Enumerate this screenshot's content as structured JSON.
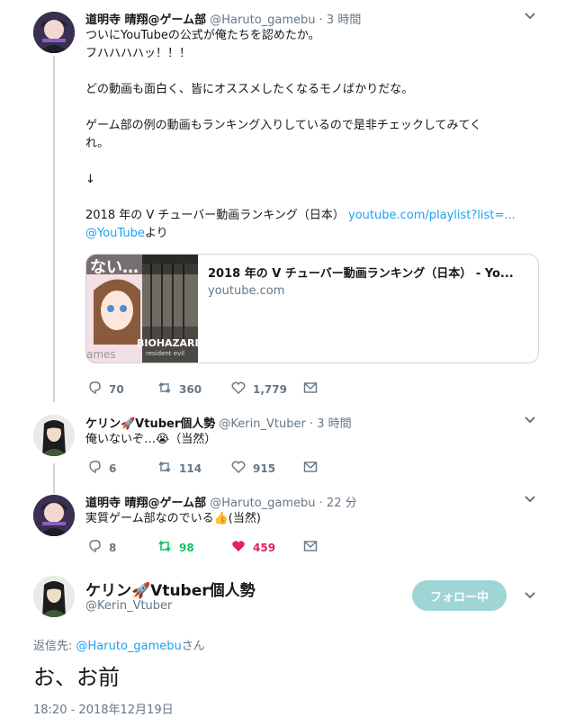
{
  "tweets": [
    {
      "name": "道明寺 晴翔@ゲーム部",
      "handle": "@Haruto_gamebu",
      "time": "· 3 時間",
      "lines": [
        "ついにYouTubeの公式が俺たちを認めたか。",
        "フハハハハッ！！！",
        "どの動画も面白く、皆にオススメしたくなるモノばかりだな。",
        "ゲーム部の例の動画もランキング入りしているので是非チェックしてみてく",
        "れ。",
        "↓",
        "2018 年の V チューバー動画ランキング（日本）"
      ],
      "link_url": "youtube.com/playlist?list=...",
      "mention": "@YouTube",
      "mention_suffix": "より",
      "card": {
        "title": "2018 年の V チューバー動画ランキング（日本） - Yo...",
        "domain": "youtube.com",
        "img_text_top": "ない…",
        "img_text_bottom": "BIOHAZARD",
        "img_text_sub": "resident evil",
        "img_text_left": "ames"
      },
      "replies": "70",
      "retweets": "360",
      "likes": "1,779"
    },
    {
      "name": "ケリン🚀Vtuber個人勢",
      "handle": "@Kerin_Vtuber",
      "time": "· 3 時間",
      "text": "俺いないぞ…😭（当然）",
      "replies": "6",
      "retweets": "114",
      "likes": "915"
    },
    {
      "name": "道明寺 晴翔@ゲーム部",
      "handle": "@Haruto_gamebu",
      "time": "· 22 分",
      "text": "実質ゲーム部なのでいる👍(当然)",
      "replies": "8",
      "retweets": "98",
      "likes": "459"
    }
  ],
  "focused": {
    "name": "ケリン🚀Vtuber個人勢",
    "handle": "@Kerin_Vtuber",
    "follow_label": "フォロー中",
    "reply_prefix": "返信先: ",
    "reply_handle": "@Haruto_gamebu",
    "reply_suffix": "さん",
    "text": "お、お前",
    "timestamp": "18:20 - 2018年12月19日"
  },
  "colors": {
    "link": "#1da1f2",
    "retweet_active": "#17bf63",
    "like_active": "#e0245e",
    "follow_button": "#9fd5d4",
    "secondary_text": "#657786"
  }
}
